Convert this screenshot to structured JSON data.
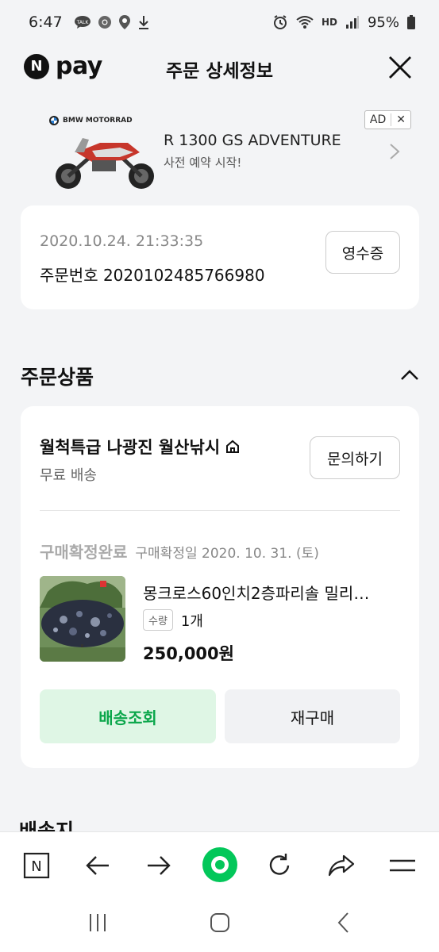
{
  "status_bar": {
    "time": "6:47",
    "battery": "95%",
    "talk_badge": "TALK",
    "hd_label": "HD"
  },
  "header": {
    "logo_letter": "N",
    "logo_text": "pay",
    "title": "주문 상세정보"
  },
  "ad": {
    "brand": "BMW MOTORRAD",
    "title": "R 1300 GS ADVENTURE",
    "subtitle": "사전 예약 시작!",
    "badge": "AD",
    "badge_close": "✕"
  },
  "order": {
    "datetime": "2020.10.24. 21:33:35",
    "number_label": "주문번호 2020102485766980",
    "receipt_label": "영수증"
  },
  "section": {
    "title": "주문상품",
    "next_title": "배송지"
  },
  "product": {
    "store_name": "월척특급 나광진 월산낚시",
    "shipping": "무료 배송",
    "inquiry_label": "문의하기",
    "status": "구매확정완료",
    "status_date": "구매확정일 2020. 10. 31. (토)",
    "name": "몽크로스60인치2층파리솔 밀리…",
    "qty_label": "수량",
    "qty_value": "1개",
    "price": "250,000원",
    "track_label": "배송조회",
    "rebuy_label": "재구매"
  },
  "toolbar": {
    "home_letter": "N"
  },
  "colors": {
    "accent_green": "#0aa64a",
    "track_bg": "#dff6e5",
    "naver_green": "#03c75a"
  }
}
